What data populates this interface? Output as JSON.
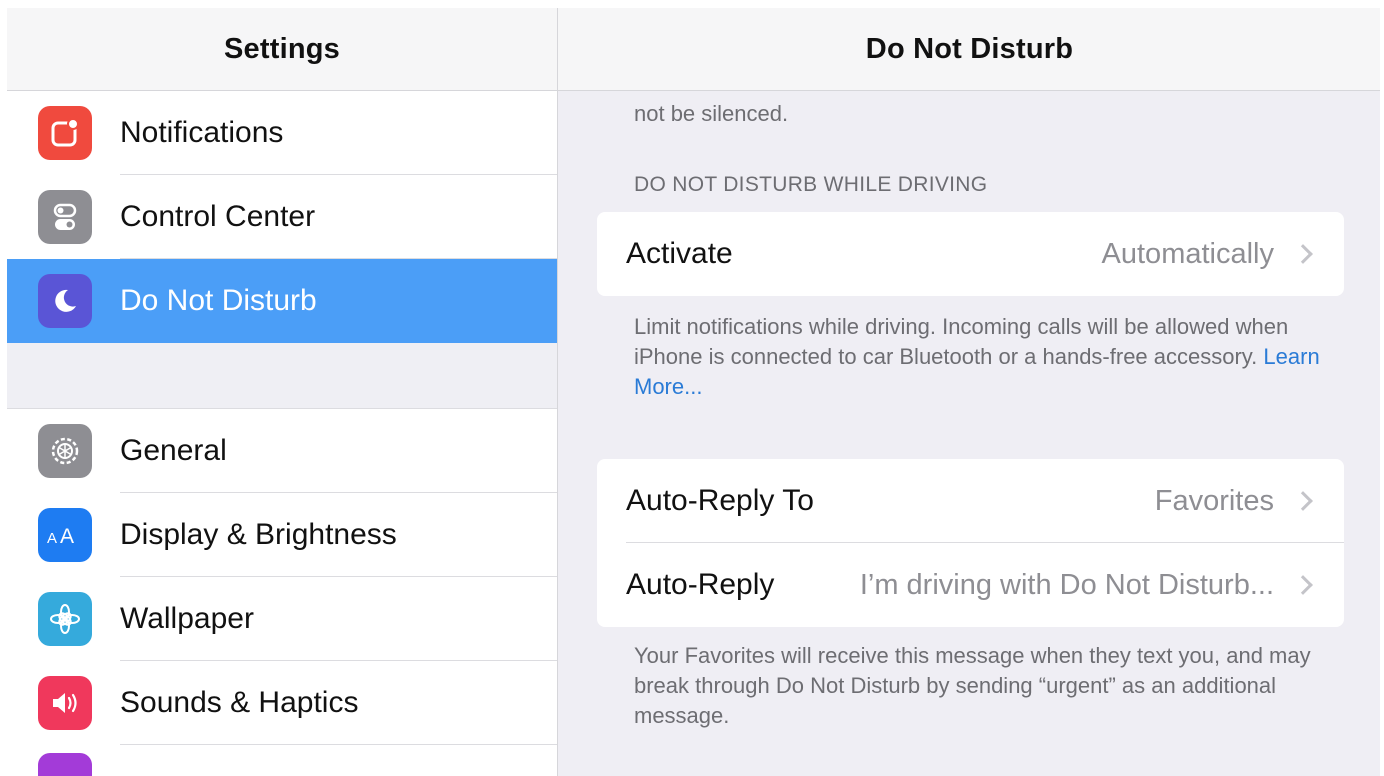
{
  "sidebar": {
    "title": "Settings",
    "items": [
      {
        "label": "Notifications",
        "icon": "notifications-icon",
        "color": "#f04a3e"
      },
      {
        "label": "Control Center",
        "icon": "control-center-icon",
        "color": "#8e8e93"
      },
      {
        "label": "Do Not Disturb",
        "icon": "moon-icon",
        "color": "#5a55d6",
        "selected": true
      },
      {
        "label": "General",
        "icon": "gear-icon",
        "color": "#8e8e93"
      },
      {
        "label": "Display & Brightness",
        "icon": "display-brightness-icon",
        "color": "#1e7cf2"
      },
      {
        "label": "Wallpaper",
        "icon": "wallpaper-icon",
        "color": "#35aadc"
      },
      {
        "label": "Sounds & Haptics",
        "icon": "sounds-icon",
        "color": "#f0385c"
      }
    ]
  },
  "detail": {
    "title": "Do Not Disturb",
    "top_note_line2": "not be silenced.",
    "driving_header": "DO NOT DISTURB WHILE DRIVING",
    "activate": {
      "label": "Activate",
      "value": "Automatically"
    },
    "driving_note": "Limit notifications while driving. Incoming calls will be allowed when iPhone is connected to car Bluetooth or a hands-free accessory.",
    "learn_more": "Learn More...",
    "auto_reply_to": {
      "label": "Auto-Reply To",
      "value": "Favorites"
    },
    "auto_reply": {
      "label": "Auto-Reply",
      "value": "I’m driving with Do Not Disturb..."
    },
    "favorites_note": "Your Favorites will receive this message when they text you, and may break through Do Not Disturb by sending “urgent” as an additional message."
  },
  "colors": {
    "selection": "#4b9ef7",
    "link": "#2a7bd6",
    "background": "#efeef4"
  }
}
